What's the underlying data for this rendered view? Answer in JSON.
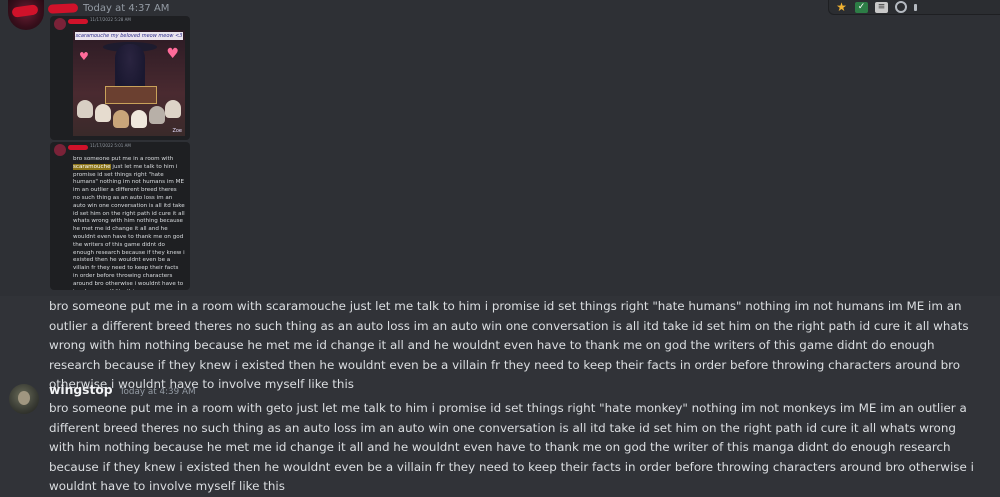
{
  "message1": {
    "timestamp": "Today at 4:37 AM",
    "attachment1": {
      "timestamp": "11/17/2022 5:28 AM",
      "caption": "scaramouche my beloved meow meow <3",
      "signature": "Zoe"
    },
    "attachment2": {
      "timestamp": "11/17/2022 5:01 AM",
      "text_before": "bro someone put me in a room with ",
      "highlight": "scaramouche",
      "text_after": " just let me talk to him i promise id set things right \"hate humans\" nothing im not humans im ME im an outlier a different breed theres no such thing as an auto loss im an auto win one conversation is all itd take id set him on the right path id cure it all whats wrong with him nothing because he met me id change it all and he wouldnt even have to thank me on god the writers of this game didnt do enough research because if they knew i existed then he wouldnt even be a villain fr they need to keep their facts in order before throwing characters around bro otherwise i wouldnt have to involve myself like this"
    },
    "text": "bro someone put me in a room with scaramouche just let me talk to him i promise id set things right \"hate humans\" nothing im not humans im ME im an outlier a different breed theres no such thing as an auto loss im an auto win one conversation is all itd take id set him on the right path id cure it all whats wrong with him nothing because he met me id change it all and he wouldnt even have to thank me on god the writers of this game didnt do enough research because if they knew i existed then he wouldnt even be a villain fr they need to keep their facts in order before throwing characters around bro otherwise i wouldnt have to involve myself like this"
  },
  "message2": {
    "username": "wingstop",
    "timestamp": "Today at 4:39 AM",
    "text": "bro someone put me in a room with geto just let me talk to him i promise id set things right \"hate monkey\" nothing im not monkeys im ME im an outlier a different breed theres no such thing as an auto loss im an auto win one conversation is all itd take id set him on the right path id cure it all whats wrong with him nothing because he met me id change it all and he wouldnt even have to thank me on god the writer of this manga didnt do enough research because if they knew i existed then he wouldnt even be a villain fr they need to keep their facts in order before throwing characters around bro otherwise i wouldnt have to involve myself like this"
  },
  "toolbar": {
    "icons": [
      "star-icon",
      "check-icon",
      "document-icon",
      "reply-icon",
      "more-icon"
    ]
  },
  "colors": {
    "background": "#313338",
    "hover_background": "#2e3035",
    "text": "#dbdee1",
    "muted": "#949ba4",
    "redaction": "#d0122a",
    "highlight": "#8a7318"
  }
}
